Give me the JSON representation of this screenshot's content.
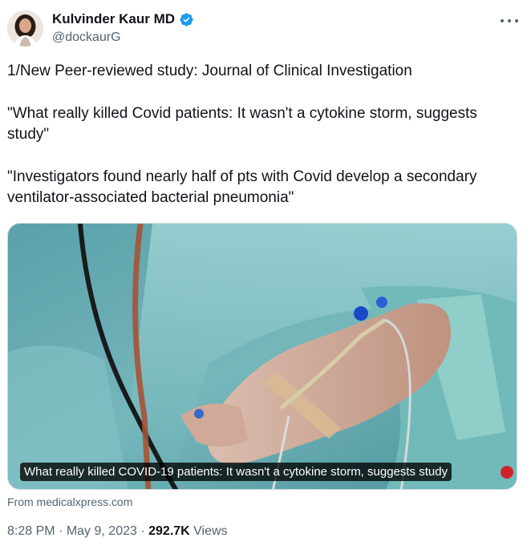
{
  "author": {
    "display_name": "Kulvinder Kaur MD",
    "handle": "@dockaurG",
    "verified": true,
    "verified_color": "#1d9bf0"
  },
  "tweet": {
    "paragraphs": [
      "1/New Peer-reviewed study: Journal of Clinical Investigation",
      "\"What really killed Covid patients: It wasn't a cytokine storm, suggests study\"",
      "\"Investigators found nearly half of pts with Covid develop a secondary ventilator-associated bacterial pneumonia\""
    ]
  },
  "media": {
    "caption": "What really killed COVID-19 patients: It wasn't a cytokine storm, suggests study",
    "source": "From medicalxpress.com",
    "image_subject": "hand-with-iv-line"
  },
  "meta": {
    "time": "8:28 PM",
    "separator_1": "·",
    "date": "May 9, 2023",
    "separator_2": "·",
    "views_count": "292.7K",
    "views_label": "Views"
  },
  "icons": {
    "more": "more-icon",
    "verified": "verified-badge-icon"
  }
}
